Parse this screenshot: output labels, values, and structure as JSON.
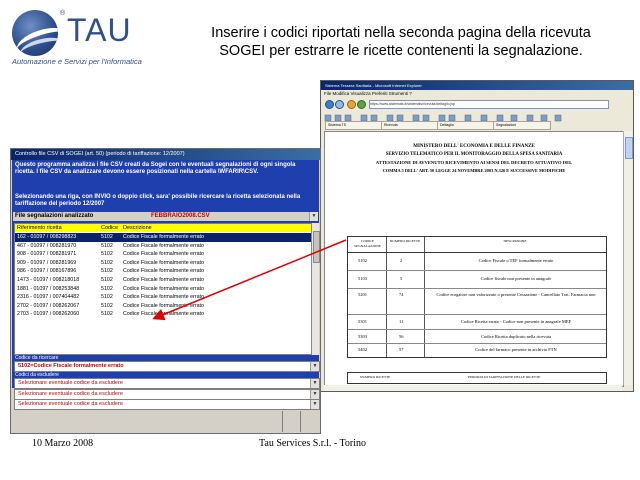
{
  "brand": {
    "name": "TAU",
    "tagline": "Automazione e Servizi per l'Informatica",
    "reg_mark": "®"
  },
  "heading": {
    "line1": "Inserire i codici  riportati nella seconda pagina della ricevuta",
    "line2": "SOGEI per estrarre le ricette contenenti la segnalazione."
  },
  "footer": {
    "date": "10 Marzo 2008",
    "company": "Tau Services S.r.l. - Torino"
  },
  "app": {
    "title": "Controllo file CSV di SOGEI (art. 50) (periodo di tariffazione: 12/2007)",
    "description": "Questo programma analizza i file CSV creati da Sogei con le eventuali segnalazioni di ogni singola ricetta. I file CSV da analizzare devono essere posizionati nella cartella \\WFARIR\\CSV.",
    "hint": "Selezionando una riga, con INVIO o doppio click, sara' possibile ricercare la ricetta selezionata nella tariffazione del periodo 12/2007",
    "files_label": "File segnalazioni analizzato",
    "files_value": "FEBBRAIO2008.CSV",
    "columns": [
      "Riferimento ricetta",
      "Codice",
      "Descrizione"
    ],
    "rows": [
      {
        "ref": "162 - 01097 / 008298823",
        "code": "5102",
        "desc": "Codice Fiscale formalmente errato",
        "selected": true
      },
      {
        "ref": "467 - 01097 / 008281970",
        "code": "5102",
        "desc": "Codice Fiscale formalmente errato",
        "selected": false
      },
      {
        "ref": "908 - 01097 / 008281971",
        "code": "5102",
        "desc": "Codice Fiscale formalmente errato",
        "selected": false
      },
      {
        "ref": "909 - 01097 / 008281969",
        "code": "5102",
        "desc": "Codice Fiscale formalmente errato",
        "selected": false
      },
      {
        "ref": "986 - 01097 / 008167896",
        "code": "5102",
        "desc": "Codice Fiscale formalmente errato",
        "selected": false
      },
      {
        "ref": "1473 - 01097 / 008218018",
        "code": "5102",
        "desc": "Codice Fiscale formalmente errato",
        "selected": false
      },
      {
        "ref": "1881 - 01097 / 008253848",
        "code": "5102",
        "desc": "Codice Fiscale formalmente errato",
        "selected": false
      },
      {
        "ref": "2316 - 01097 / 007404482",
        "code": "5102",
        "desc": "Codice Fiscale formalmente errato",
        "selected": false
      },
      {
        "ref": "2702 - 01097 / 008262067",
        "code": "5102",
        "desc": "Codice Fiscale formalmente errato",
        "selected": false
      },
      {
        "ref": "2703 - 01097 / 008262060",
        "code": "5102",
        "desc": "Codice Fiscale formalmente errato",
        "selected": false
      }
    ],
    "code_label": "Codice da ricercare",
    "code_value": "5102=Codice Fiscale formalmente errato",
    "exclude_label": "Codici da escludere",
    "exclude_options": [
      "Selezionare eventuale codice da escludere",
      "Selezionare eventuale codice da escludere",
      "Selezionare eventuale codice da escludere"
    ]
  },
  "browser": {
    "title": "Sistema Tessera Sanitaria - Microsoft Internet Explorer",
    "menu": "File  Modifica  Visualizza  Preferiti  Strumenti  ?",
    "address": "https://www.sistemats.it/sistemats/ricevuta/dettaglio.jsp",
    "tabs": [
      "Sistema TS",
      "Ricevuta",
      "Dettaglio",
      "Segnalazioni"
    ],
    "doc_lines": [
      "MINISTERO DELL' ECONOMIA E DELLE FINANZE",
      "SERVIZIO TELEMATICO PER IL MONITORAGGIO DELLA SPESA SANITARIA",
      "ATTESTAZIONE DI AVVENUTO RICEVIMENTO AI SENSI DEL DECRETO ATTUATIVO DEL",
      "COMMA 5 DELL' ART. 50 LEGGE 24 NOVEMBRE 2003 N.326 E SUCCESSIVE MODIFICHE"
    ],
    "table_headers": [
      "CODICE SEGNALAZIONE",
      "NUMERO RICETTE",
      "DESCRIZIONE"
    ],
    "table_rows": [
      {
        "code": "5102",
        "count": "2",
        "desc": "Codice Fiscale o TEF formalmente errato"
      },
      {
        "code": "5103",
        "count": "5",
        "desc": "Codice fiscale non presente in anagrafe"
      },
      {
        "code": "5201",
        "count": "74",
        "desc": "Codice erogatore non valorizzato o presente Cessazione - Cancellato Trat. Farmacia non"
      },
      {
        "code": "5301",
        "count": "11",
        "desc": "Codice Ricetta errato - Codice non presente in anagrafe MEF"
      },
      {
        "code": "5303",
        "count": "56",
        "desc": "Codice Ricetta duplicato nella ricevuta"
      },
      {
        "code": "5402",
        "count": "57",
        "desc": "Codice del farmaco presente in archivio FTN"
      }
    ],
    "table2_headers": [
      "NUMERO RICETTE",
      "PERIODO DI TARIFFAZIONE DELLE RICETTE"
    ]
  }
}
